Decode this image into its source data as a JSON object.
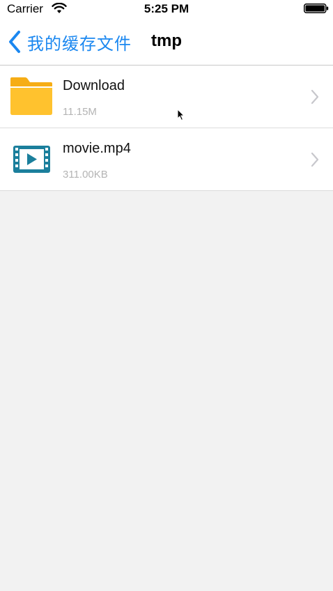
{
  "status_bar": {
    "carrier": "Carrier",
    "time": "5:25 PM",
    "wifi_icon": "wifi-icon",
    "battery_icon": "battery-icon"
  },
  "nav": {
    "back_label": "我的缓存文件",
    "back_icon": "chevron-left-icon",
    "title": "tmp",
    "accent_color": "#1a87f0"
  },
  "files": [
    {
      "name": "Download",
      "size": "11.15M",
      "icon": "folder-icon",
      "icon_color": "#ffc22e"
    },
    {
      "name": "movie.mp4",
      "size": "311.00KB",
      "icon": "video-file-icon",
      "icon_color": "#1b7f9c"
    }
  ],
  "colors": {
    "background": "#f2f2f2",
    "secondary_text": "#b4b4b4",
    "chevron": "#c7c7cc"
  }
}
